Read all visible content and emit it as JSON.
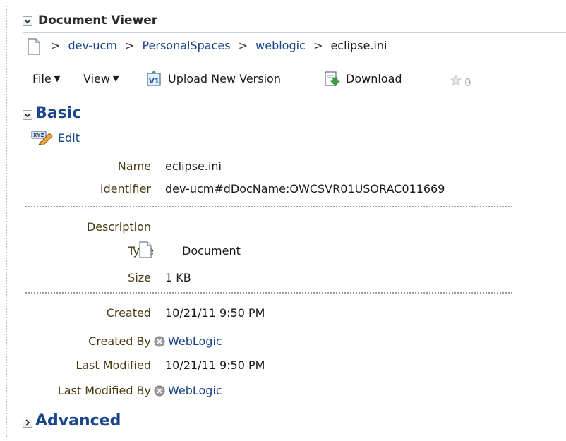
{
  "viewer": {
    "title": "Document Viewer"
  },
  "breadcrumb": {
    "items": [
      {
        "label": "dev-ucm",
        "link": true
      },
      {
        "label": "PersonalSpaces",
        "link": true
      },
      {
        "label": "weblogic",
        "link": true
      },
      {
        "label": "eclipse.ini",
        "link": false
      }
    ],
    "separator": ">"
  },
  "toolbar": {
    "file_label": "File",
    "view_label": "View",
    "upload_label": "Upload New Version",
    "download_label": "Download",
    "star_count": "0"
  },
  "basic": {
    "title": "Basic",
    "edit_label": "Edit",
    "fields": {
      "name": {
        "label": "Name",
        "value": "eclipse.ini"
      },
      "identifier": {
        "label": "Identifier",
        "value": "dev-ucm#dDocName:OWCSVR01USORAC011669"
      },
      "description": {
        "label": "Description",
        "value": ""
      },
      "type": {
        "label": "Type",
        "value": "Document"
      },
      "size": {
        "label": "Size",
        "value": "1 KB"
      },
      "created": {
        "label": "Created",
        "value": "10/21/11 9:50 PM"
      },
      "created_by": {
        "label": "Created By",
        "value": "WebLogic"
      },
      "last_modified": {
        "label": "Last Modified",
        "value": "10/21/11 9:50 PM"
      },
      "last_modified_by": {
        "label": "Last Modified By",
        "value": "WebLogic"
      }
    }
  },
  "advanced": {
    "title": "Advanced"
  },
  "colors": {
    "link": "#18458b",
    "label": "#4a3a10",
    "rule": "#a9c0da"
  }
}
